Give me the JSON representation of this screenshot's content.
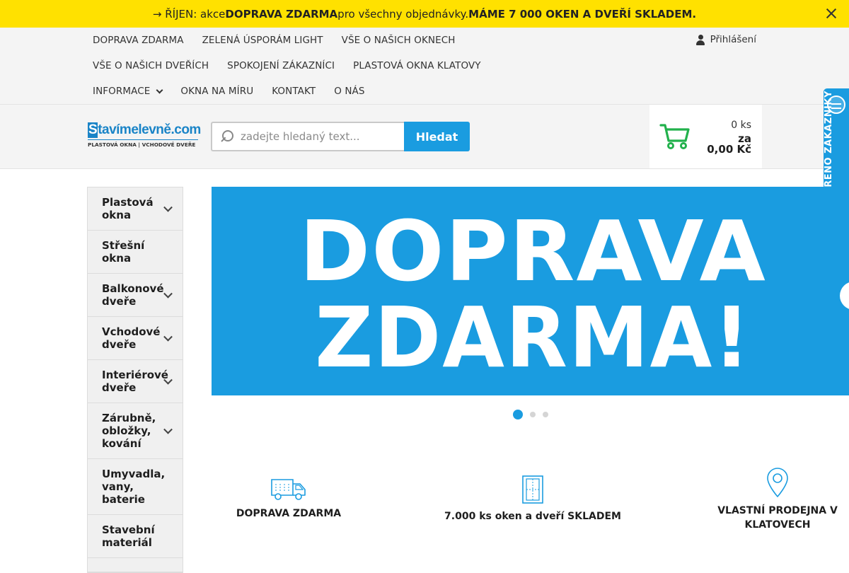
{
  "notice": {
    "prefix": "→ ŘÍJEN: akce ",
    "highlight1": "DOPRAVA ZDARMA",
    "middle": " pro všechny objednávky. ",
    "highlight2": "MÁME 7 000 OKEN A DVEŘÍ SKLADEM.",
    "close_icon": "close-icon",
    "background": "#ffe100"
  },
  "nav": {
    "row1": [
      "DOPRAVA ZDARMA",
      "ZELENÁ ÚSPORÁM LIGHT",
      "VŠE O NAŠICH OKNECH"
    ],
    "row2": [
      "VŠE O NAŠICH DVEŘÍCH",
      "SPOKOJENÍ ZÁKAZNÍCI",
      "PLASTOVÁ OKNA KLATOVY"
    ],
    "row3": [
      "INFORMACE",
      "OKNA NA MÍRU",
      "KONTAKT",
      "O NÁS"
    ],
    "login": "Přihlášení"
  },
  "header": {
    "logo_brand_s": "S",
    "logo_brand_rest": "tavímelevně",
    "logo_brand_domain": ".com",
    "logo_tagline": "PLASTOVÁ OKNA | VCHODOVÉ DVEŘE",
    "search_placeholder": "zadejte hledaný text...",
    "search_button": "Hledat",
    "cart_qty": "0 ks",
    "cart_za": "za",
    "cart_price": "0,00 Kč",
    "accent": "#1a9ce0",
    "cart_icon_color": "#22b14c"
  },
  "verified_tab": {
    "label": "OVĚŘENO ZÁKAZNÍKY"
  },
  "sidebar": {
    "items": [
      {
        "label": "Plastová okna",
        "has_submenu": true
      },
      {
        "label": "Střešní okna",
        "has_submenu": false
      },
      {
        "label": "Balkonové dveře",
        "has_submenu": true
      },
      {
        "label": "Vchodové dveře",
        "has_submenu": true
      },
      {
        "label": "Interiérové dveře",
        "has_submenu": true
      },
      {
        "label": "Zárubně, obložky, kování",
        "has_submenu": true
      },
      {
        "label": "Umyvadla, vany, baterie",
        "has_submenu": false
      },
      {
        "label": "Stavební materiál",
        "has_submenu": false
      }
    ]
  },
  "banner": {
    "line1": "DOPRAVA",
    "line2": "ZDARMA!",
    "slides_total": 3,
    "active_slide": 1
  },
  "features": [
    {
      "label": "DOPRAVA ZDARMA",
      "icon": "truck-icon"
    },
    {
      "label": "7.000 ks oken a dveří SKLADEM",
      "icon": "door-icon"
    },
    {
      "label": "VLASTNÍ PRODEJNA V KLATOVECH",
      "icon": "map-pin-icon"
    }
  ]
}
